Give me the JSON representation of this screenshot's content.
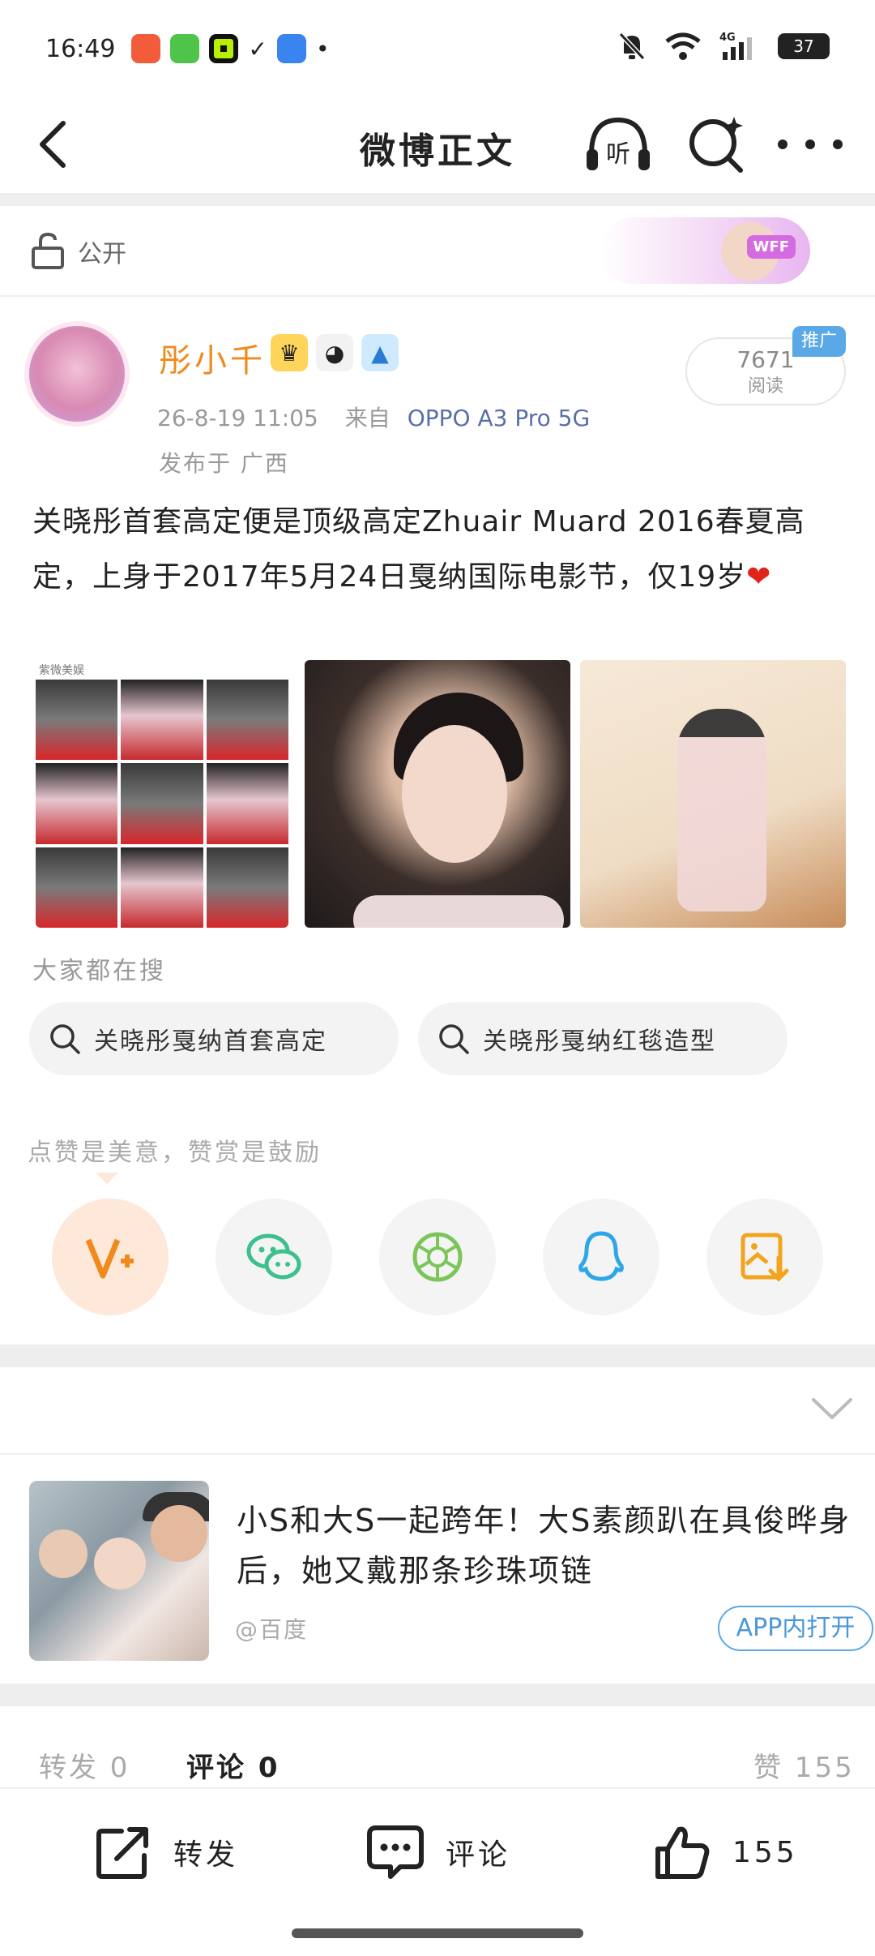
{
  "status_bar": {
    "time": "16:49",
    "battery": "37",
    "network": "4G"
  },
  "nav": {
    "title": "微博正文",
    "listen_label": "听"
  },
  "visibility": {
    "label": "公开"
  },
  "promo_banner": {
    "tag": "WFF"
  },
  "author": {
    "name": "彤小千",
    "badges": [
      "crown-badge",
      "panda-badge",
      "shark-badge"
    ]
  },
  "post": {
    "date": "26-8-19 11:05",
    "from_label": "来自",
    "device": "OPPO A3 Pro 5G",
    "location": "发布于 广西",
    "reads_count": "7671",
    "reads_label": "阅读",
    "promo_tag": "推广",
    "text": "关晓彤首套高定便是顶级高定Zhuair Muard 2016春夏高定，上身于2017年5月24日戛纳国际电影节，仅19岁",
    "emoji": "❤",
    "image_label": "紫微美娱"
  },
  "search": {
    "title": "大家都在搜",
    "chips": [
      "关晓彤戛纳首套高定",
      "关晓彤戛纳红毯造型"
    ]
  },
  "tip": {
    "text": "点赞是美意，赞赏是鼓励"
  },
  "share": {
    "buttons": [
      "v-plus-icon",
      "wechat-icon",
      "moments-icon",
      "qq-icon",
      "save-image-icon"
    ]
  },
  "recommend": {
    "title": "小S和大S一起跨年！大S素颜趴在具俊晔身后，她又戴那条珍珠项链",
    "source": "@百度",
    "open_label": "APP内打开"
  },
  "stats": {
    "repost": "转发 0",
    "comment": "评论 0",
    "like": "赞 155"
  },
  "toolbar": {
    "repost_label": "转发",
    "comment_label": "评论",
    "like_count": "155"
  },
  "colors": {
    "accent_orange": "#f08a1c",
    "link_blue": "#4a98d8",
    "wechat_green": "#3cc08d",
    "qq_blue": "#2fa6e8",
    "save_orange": "#f3a41e"
  }
}
